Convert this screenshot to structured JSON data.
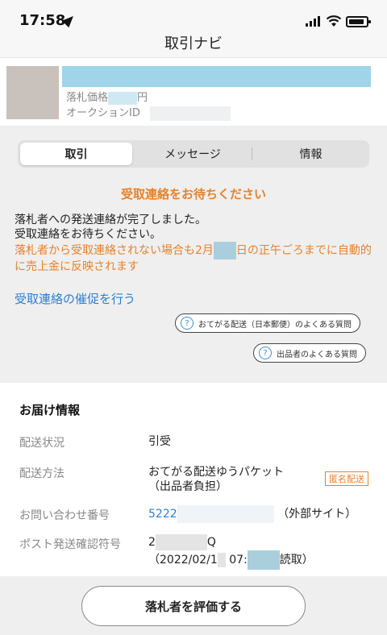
{
  "status_bar": {
    "time": "17:58"
  },
  "nav": {
    "title": "取引ナビ"
  },
  "item": {
    "price_label": "落札価格",
    "price_suffix": "円",
    "auction_id_label": "オークションID"
  },
  "tabs": [
    {
      "label": "取引",
      "active": true
    },
    {
      "label": "メッセージ",
      "active": false
    },
    {
      "label": "情報",
      "active": false
    }
  ],
  "notice": {
    "heading": "受取連絡をお待ちください",
    "line1": "落札者への発送連絡が完了しました。",
    "line2": "受取連絡をお待ちください。",
    "orange_part1": "落札者から受取連絡されない場合も2月",
    "orange_part2": "日の正午ごろまでに自動的に売上金に反映されます",
    "remind_link": "受取連絡の催促を行う",
    "faq1": "おてがる配送（日本郵便）のよくある質問",
    "faq2": "出品者のよくある質問",
    "q_mark": "?"
  },
  "delivery": {
    "title": "お届け情報",
    "status_label": "配送状況",
    "status_value": "引受",
    "method_label": "配送方法",
    "method_value1": "おてがる配送ゆうパケット",
    "method_value2": "（出品者負担）",
    "anonymous_badge": "匿名配送",
    "tracking_label": "お問い合わせ番号",
    "tracking_prefix": "5222",
    "tracking_external": "（外部サイト）",
    "post_code_label": "ポスト発送確認符号",
    "post_code_prefix": "2",
    "post_code_suffix": "Q",
    "post_time_part1": "（2022/02/1",
    "post_time_part2": "07:",
    "post_time_part3": "読取）"
  },
  "bottom": {
    "rate_button": "落札者を評価する"
  },
  "colors": {
    "accent_orange": "#e8822a",
    "link_blue": "#2e7fd0",
    "tab_bg": "#e1e1e1",
    "section_gray": "#efefef"
  }
}
